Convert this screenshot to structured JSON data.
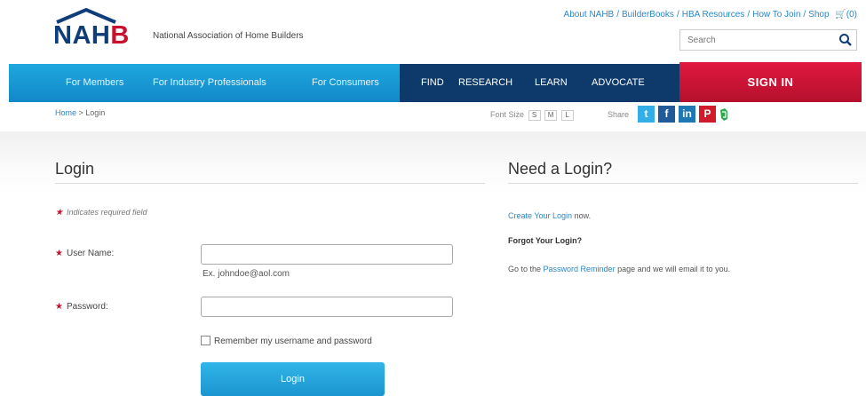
{
  "header": {
    "logo_text_a": "NAH",
    "logo_text_b": "B",
    "org_name": "National Association of Home Builders",
    "top_links": [
      "About NAHB",
      "BuilderBooks",
      "HBA Resources",
      "How To Join",
      "Shop"
    ],
    "cart_count": "(0)",
    "search_placeholder": "Search"
  },
  "nav": {
    "items_light": [
      "For Members",
      "For Industry Professionals",
      "For Consumers"
    ],
    "items_dark": [
      "FIND",
      "RESEARCH",
      "LEARN",
      "ADVOCATE"
    ],
    "signin_label": "SIGN IN"
  },
  "utility": {
    "breadcrumb_home": "Home",
    "breadcrumb_sep": " > ",
    "breadcrumb_current": "Login",
    "font_size_label": "Font Size",
    "font_sizes": [
      "S",
      "M",
      "L"
    ],
    "share_label": "Share",
    "social": {
      "twitter": "t",
      "facebook": "f",
      "linkedin": "in",
      "pinterest": "P"
    }
  },
  "login": {
    "title": "Login",
    "required_note": "Indicates required field",
    "username_label": "User Name:",
    "username_hint": "Ex. johndoe@aol.com",
    "password_label": "Password:",
    "remember_label": "Remember my username and password",
    "button_label": "Login"
  },
  "need": {
    "title": "Need a Login?",
    "create_link": "Create Your Login",
    "create_suffix": " now.",
    "forgot_title": "Forgot Your Login?",
    "forgot_prefix": "Go to the ",
    "forgot_link": "Password Reminder",
    "forgot_suffix": " page and we will email it to you."
  },
  "colors": {
    "brand_blue": "#0f3d7a",
    "brand_red": "#c8102e",
    "nav_blue": "#1fa8df",
    "nav_dark": "#0d3a6a",
    "link_blue": "#2b87c7"
  }
}
